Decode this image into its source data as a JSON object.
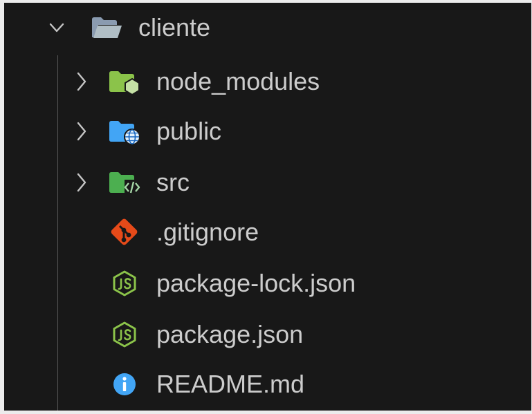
{
  "root": {
    "label": "cliente",
    "expanded": true,
    "icon": "folder-open-icon"
  },
  "items": [
    {
      "label": "node_modules",
      "kind": "folder",
      "icon": "folder-node-icon",
      "color": "#8bc34a"
    },
    {
      "label": "public",
      "kind": "folder",
      "icon": "folder-public-icon",
      "color": "#42a5f5"
    },
    {
      "label": "src",
      "kind": "folder",
      "icon": "folder-src-icon",
      "color": "#4caf50"
    },
    {
      "label": ".gitignore",
      "kind": "file",
      "icon": "git-icon",
      "color": "#e64a19"
    },
    {
      "label": "package-lock.json",
      "kind": "file",
      "icon": "nodejs-icon",
      "color": "#8bc34a"
    },
    {
      "label": "package.json",
      "kind": "file",
      "icon": "nodejs-icon",
      "color": "#8bc34a"
    },
    {
      "label": "README.md",
      "kind": "file",
      "icon": "info-icon",
      "color": "#42a5f5"
    }
  ],
  "colors": {
    "background": "#181818",
    "text": "#cccccc",
    "indent_guide": "#585858"
  }
}
